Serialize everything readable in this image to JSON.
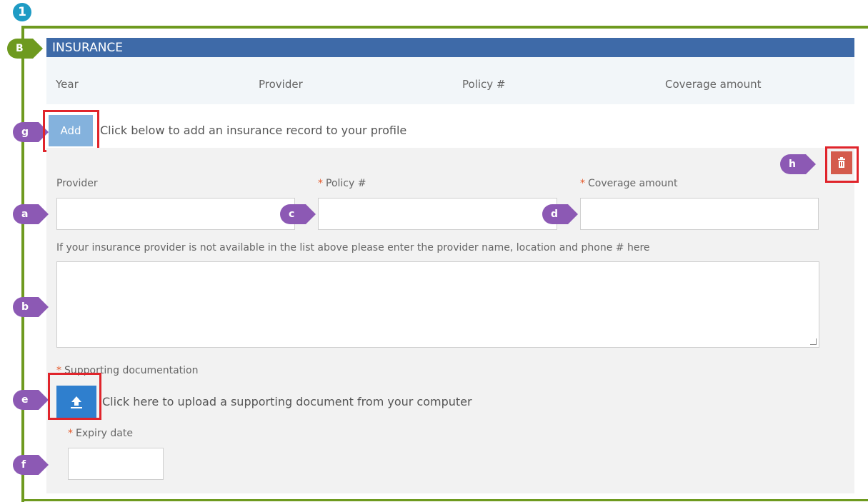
{
  "step": {
    "number": "1"
  },
  "markers": {
    "section": "B",
    "a": "a",
    "b": "b",
    "c": "c",
    "d": "d",
    "e": "e",
    "f": "f",
    "g": "g",
    "h": "h"
  },
  "section": {
    "title": "INSURANCE",
    "columns": [
      "Year",
      "Provider",
      "Policy #",
      "Coverage amount"
    ]
  },
  "add": {
    "label": "Add",
    "hint": "Click below to add an insurance record to your profile"
  },
  "form": {
    "provider_label": "Provider",
    "policy_label": "Policy #",
    "coverage_label": "Coverage amount",
    "required_mark": "*",
    "other_provider_label": "If your insurance provider is not available in the list above please enter the provider name, location and phone # here",
    "docs_label": "Supporting documentation",
    "upload_hint": "Click here to upload a supporting document from your computer",
    "expiry_label": "Expiry date"
  },
  "icons": {
    "delete": "trash-icon",
    "upload": "upload-icon"
  },
  "colors": {
    "header": "#3e6aa8",
    "guide": "#6e9a1f",
    "marker": "#8c59b4",
    "highlight": "#e0242b",
    "delete": "#d45b4c",
    "upload": "#2f7fce",
    "add": "#84b2dd"
  }
}
